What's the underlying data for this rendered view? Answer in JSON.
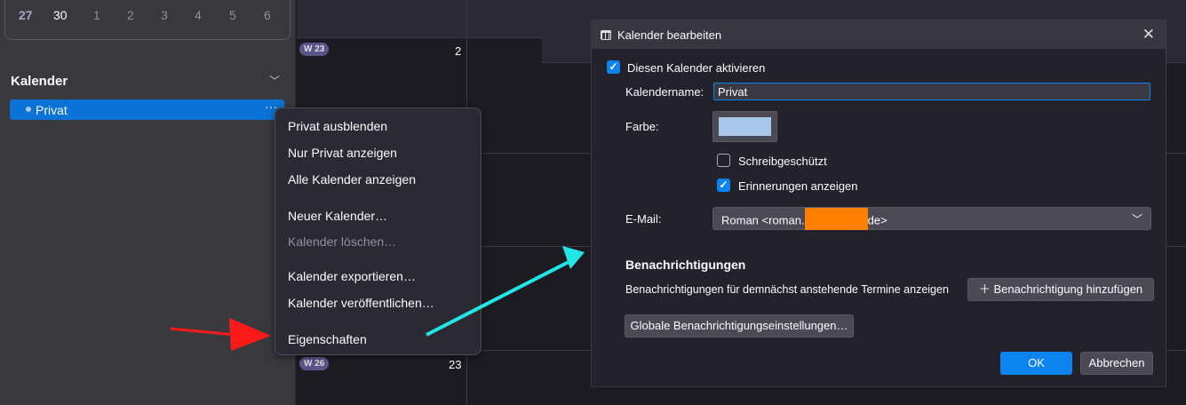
{
  "minical": {
    "days": [
      "27",
      "30",
      "1",
      "2",
      "3",
      "4",
      "5",
      "6"
    ]
  },
  "sidebar": {
    "section_title": "Kalender",
    "calendars": [
      {
        "name": "Privat",
        "more": "···"
      }
    ]
  },
  "grid": {
    "week1": "W 23",
    "day1": "2",
    "week2": "W 26",
    "day2": "23"
  },
  "context_menu": {
    "items": [
      "Privat ausblenden",
      "Nur Privat anzeigen",
      "Alle Kalender anzeigen",
      "Neuer Kalender…",
      "Kalender löschen…",
      "Kalender exportieren…",
      "Kalender veröffentlichen…",
      "Eigenschaften"
    ]
  },
  "dialog": {
    "title": "Kalender bearbeiten",
    "close": "✕",
    "enable_label": "Diesen Kalender aktivieren",
    "name_label": "Kalendername:",
    "name_value": "Privat",
    "color_label": "Farbe:",
    "color_value": "#a9c7e8",
    "readonly_label": "Schreibgeschützt",
    "reminders_label": "Erinnerungen anzeigen",
    "email_label": "E-Mail:",
    "email_prefix": "Roman <roman.",
    "email_suffix": "de>",
    "notifications_heading": "Benachrichtigungen",
    "notifications_text": "Benachrichtigungen für demnächst anstehende Termine anzeigen",
    "add_notification": "Benachrichtigung hinzufügen",
    "global_settings": "Globale Benachrichtigungseinstellungen…",
    "ok": "OK",
    "cancel": "Abbrechen"
  },
  "annotations": {
    "red_arrow_color": "#ff1a1a",
    "cyan_arrow_color": "#22e6e6"
  }
}
